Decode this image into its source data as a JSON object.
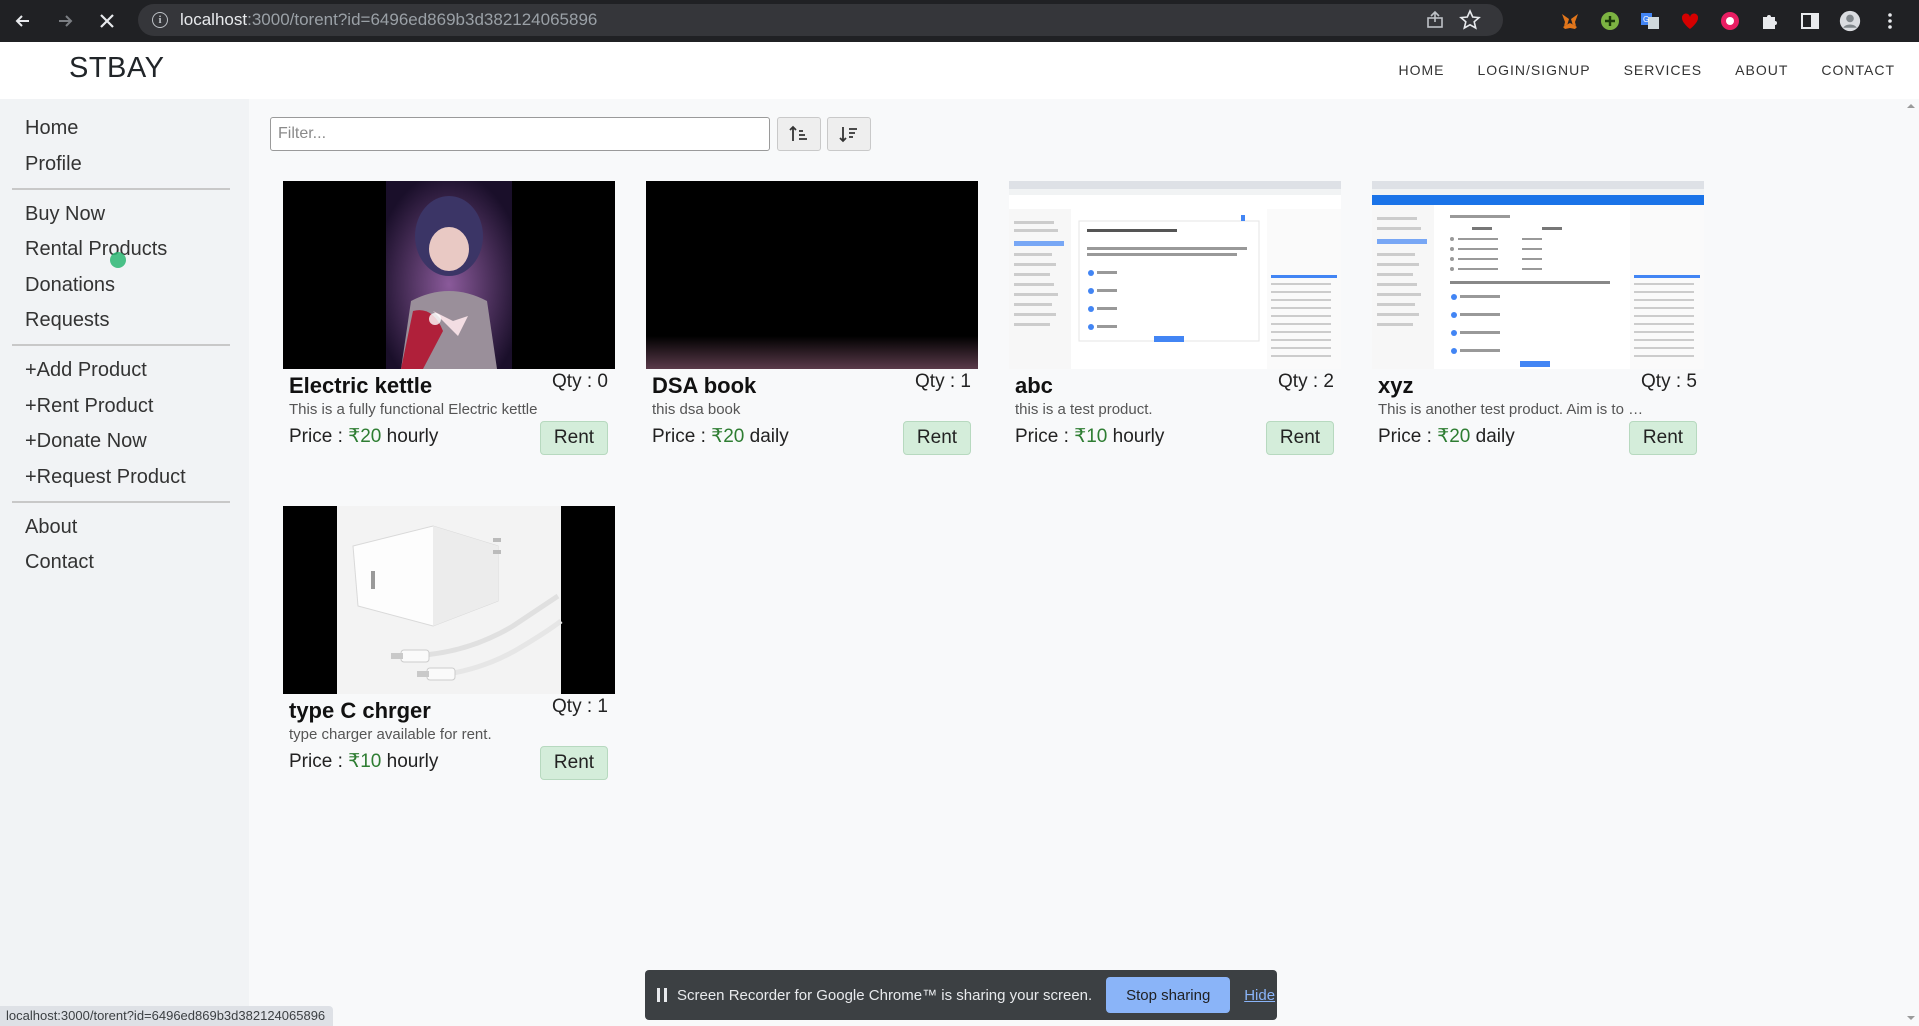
{
  "browser": {
    "url_host": "localhost",
    "url_path": ":3000/torent?id=6496ed869b3d382124065896",
    "status_url": "localhost:3000/torent?id=6496ed869b3d382124065896"
  },
  "navbar": {
    "brand": "STBAY",
    "links": [
      "HOME",
      "LOGIN/SIGNUP",
      "SERVICES",
      "ABOUT",
      "CONTACT"
    ]
  },
  "sidebar": {
    "items": [
      "Home",
      "Profile",
      "Buy Now",
      "Rental Products",
      "Donations",
      "Requests",
      "+Add Product",
      "+Rent Product",
      "+Donate Now",
      "+Request Product",
      "About",
      "Contact"
    ]
  },
  "filter": {
    "placeholder": "Filter..."
  },
  "currency_symbol": "₹",
  "accent_colors": {
    "price": "#2e7d32",
    "rent_button": "#d4edda"
  },
  "products": [
    {
      "title": "Electric kettle",
      "qty_label": "Qty : 0",
      "desc": "This is a fully functional Electric kettle",
      "price_label": "Price : ",
      "amount": "20",
      "period": "hourly",
      "button": "Rent"
    },
    {
      "title": "DSA book",
      "qty_label": "Qty : 1",
      "desc": "this dsa book",
      "price_label": "Price : ",
      "amount": "20",
      "period": "daily",
      "button": "Rent"
    },
    {
      "title": "abc",
      "qty_label": "Qty : 2",
      "desc": "this is a test product.",
      "price_label": "Price : ",
      "amount": "10",
      "period": "hourly",
      "button": "Rent"
    },
    {
      "title": "xyz",
      "qty_label": "Qty : 5",
      "desc": "This is another test product. Aim is to check",
      "price_label": "Price : ",
      "amount": "20",
      "period": "daily",
      "button": "Rent"
    },
    {
      "title": "type C chrger",
      "qty_label": "Qty : 1",
      "desc": "type charger available for rent.",
      "price_label": "Price : ",
      "amount": "10",
      "period": "hourly",
      "button": "Rent"
    }
  ],
  "share_bar": {
    "text": "Screen Recorder for Google Chrome™ is sharing your screen.",
    "stop": "Stop sharing",
    "hide": "Hide"
  }
}
